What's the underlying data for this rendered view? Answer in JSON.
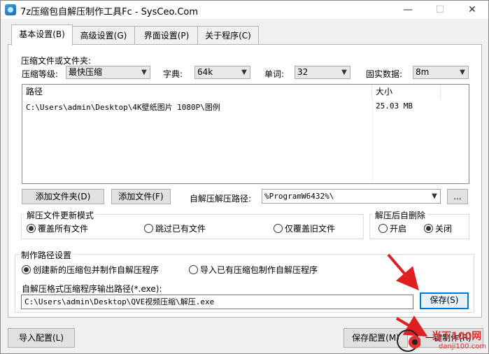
{
  "window": {
    "title": "7z压缩包自解压制作工具Fc - SysCeo.Com",
    "minimize": "—",
    "maximize": "☐",
    "close": "✕"
  },
  "tabs": [
    {
      "label": "基本设置(B)",
      "active": true
    },
    {
      "label": "高级设置(G)",
      "active": false
    },
    {
      "label": "界面设置(P)",
      "active": false
    },
    {
      "label": "关于程序(C)",
      "active": false
    }
  ],
  "compress": {
    "section_label": "压缩文件或文件夹:",
    "level_label": "压缩等级:",
    "level_value": "最快压缩",
    "dict_label": "字典:",
    "dict_value": "64k",
    "word_label": "单词:",
    "word_value": "32",
    "solid_label": "固实数据:",
    "solid_value": "8m"
  },
  "file_list": {
    "columns": [
      "路径",
      "大小"
    ],
    "rows": [
      {
        "path": "C:\\Users\\admin\\Desktop\\4K壁纸图片 1080P\\图例",
        "size": "25.03 MB"
      }
    ]
  },
  "actions": {
    "add_folder": "添加文件夹(D)",
    "add_file": "添加文件(F)",
    "extract_path_label": "自解压解压路径:",
    "extract_path_value": "%ProgramW6432%\\",
    "browse": "..."
  },
  "update_mode": {
    "legend": "解压文件更新模式",
    "options": [
      {
        "label": "覆盖所有文件",
        "selected": true
      },
      {
        "label": "跳过已有文件",
        "selected": false
      },
      {
        "label": "仅覆盖旧文件",
        "selected": false
      }
    ]
  },
  "auto_delete": {
    "legend": "解压后自删除",
    "options": [
      {
        "label": "开启",
        "selected": false
      },
      {
        "label": "关闭",
        "selected": true
      }
    ]
  },
  "build_path": {
    "legend": "制作路径设置",
    "options": [
      {
        "label": "创建新的压缩包并制作自解压程序",
        "selected": true
      },
      {
        "label": "导入已有压缩包制作自解压程序",
        "selected": false
      }
    ],
    "output_label": "自解压格式压缩程序输出路径(*.exe):",
    "output_value": "C:\\Users\\admin\\Desktop\\QVE视频压缩\\解压.exe",
    "save": "保存(S)"
  },
  "footer": {
    "import_config": "导入配置(L)",
    "save_config": "保存配置(M)",
    "one_click": "一键制作(R)"
  },
  "watermark": {
    "text": "当下100网",
    "url": "danji100.com"
  },
  "colors": {
    "annotation_arrow": "#e02020",
    "watermark": "#e03030"
  }
}
